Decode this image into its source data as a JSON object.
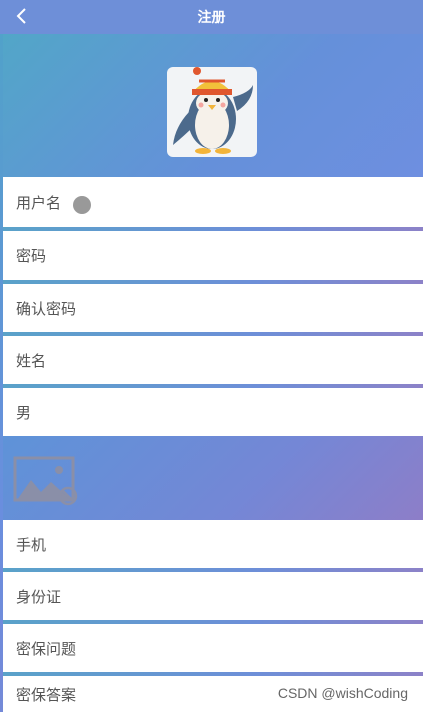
{
  "header": {
    "title": "注册",
    "back_icon": "chevron-left-icon"
  },
  "avatar": {
    "icon": "penguin-avatar-image"
  },
  "fields": [
    {
      "label": "用户名"
    },
    {
      "label": "密码"
    },
    {
      "label": "确认密码"
    },
    {
      "label": "姓名"
    },
    {
      "label": "男"
    },
    {
      "label": "手机"
    },
    {
      "label": "身份证"
    },
    {
      "label": "密保问题"
    },
    {
      "label": "密保答案"
    }
  ],
  "image_upload": {
    "icon": "image-placeholder-icon"
  },
  "watermark": "CSDN @wishCoding",
  "colors": {
    "header_bg": "#6e8fd8",
    "row_bg": "#ffffff",
    "label": "#555555"
  }
}
